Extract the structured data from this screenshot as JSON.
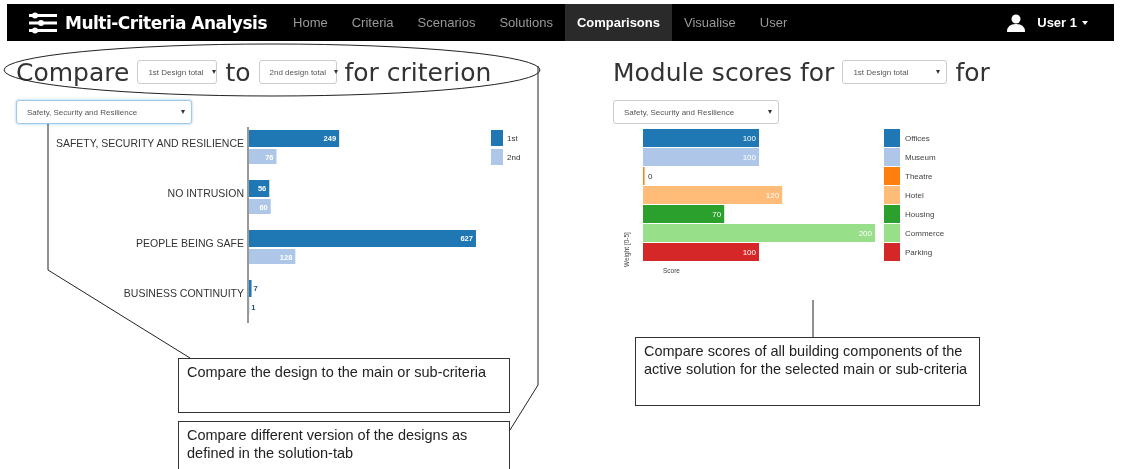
{
  "navbar": {
    "brand": "Multi-Criteria Analysis",
    "items": [
      {
        "label": "Home",
        "selected": false
      },
      {
        "label": "Criteria",
        "selected": false
      },
      {
        "label": "Scenarios",
        "selected": false
      },
      {
        "label": "Solutions",
        "selected": false
      },
      {
        "label": "Comparisons",
        "selected": true
      },
      {
        "label": "Visualise",
        "selected": false
      },
      {
        "label": "User",
        "selected": false
      }
    ],
    "user": "User 1"
  },
  "compare_panel": {
    "title_parts": [
      "Compare",
      "to",
      "for criterion"
    ],
    "design_a": "1st Design total",
    "design_b": "2nd design total",
    "criterion": "Safety, Security and Resilience",
    "chart_data": {
      "type": "bar",
      "orientation": "horizontal",
      "data_labels": true,
      "legend": true,
      "categories": [
        "SAFETY, SECURITY AND RESILIENCE",
        "NO INTRUSION",
        "PEOPLE BEING SAFE",
        "BUSINESS CONTINUITY"
      ],
      "series": [
        {
          "name": "1st",
          "color": "#1f77b4",
          "values": [
            249,
            56,
            627,
            7
          ]
        },
        {
          "name": "2nd",
          "color": "#aec7e8",
          "values": [
            76,
            60,
            128,
            1
          ]
        }
      ]
    }
  },
  "module_panel": {
    "title_parts": [
      "Module scores for",
      "for"
    ],
    "design": "1st Design total",
    "criterion": "Safety, Security and Resilience",
    "chart_data": {
      "type": "bar",
      "orientation": "horizontal",
      "data_labels": true,
      "legend": true,
      "xlabel": "Score",
      "ylabel": "Weight [0-5]",
      "series": [
        {
          "name": "Offices",
          "color": "#1f77b4",
          "values": [
            100
          ]
        },
        {
          "name": "Museum",
          "color": "#aec7e8",
          "values": [
            100
          ]
        },
        {
          "name": "Theatre",
          "color": "#ff7f0e",
          "values": [
            0
          ]
        },
        {
          "name": "Hotel",
          "color": "#ffbb78",
          "values": [
            120
          ]
        },
        {
          "name": "Housing",
          "color": "#2ca02c",
          "values": [
            70
          ]
        },
        {
          "name": "Commerce",
          "color": "#98df8a",
          "values": [
            200
          ]
        },
        {
          "name": "Parking",
          "color": "#d62728",
          "values": [
            100
          ]
        }
      ]
    }
  },
  "annotations": [
    {
      "text": "Compare the design to the main or sub-criteria"
    },
    {
      "text": "Compare different version of the designs as defined in the solution-tab"
    },
    {
      "text": "Compare scores of all building components of the active solution for the selected main or sub-criteria"
    }
  ]
}
